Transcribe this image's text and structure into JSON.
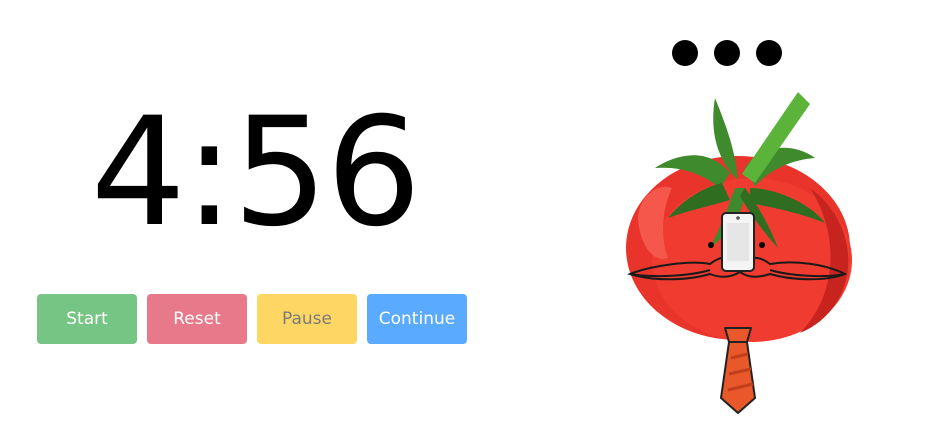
{
  "timer": {
    "display": "4:56"
  },
  "controls": {
    "start_label": "Start",
    "reset_label": "Reset",
    "pause_label": "Pause",
    "continue_label": "Continue"
  },
  "colors": {
    "start": "#76c585",
    "reset": "#e8798a",
    "pause": "#fed663",
    "continue": "#5aaaff",
    "tomato": "#ee3a2f"
  },
  "icons": {
    "status_indicator": "ellipsis-dots-icon",
    "mascot": "tomato-mascot-icon"
  }
}
